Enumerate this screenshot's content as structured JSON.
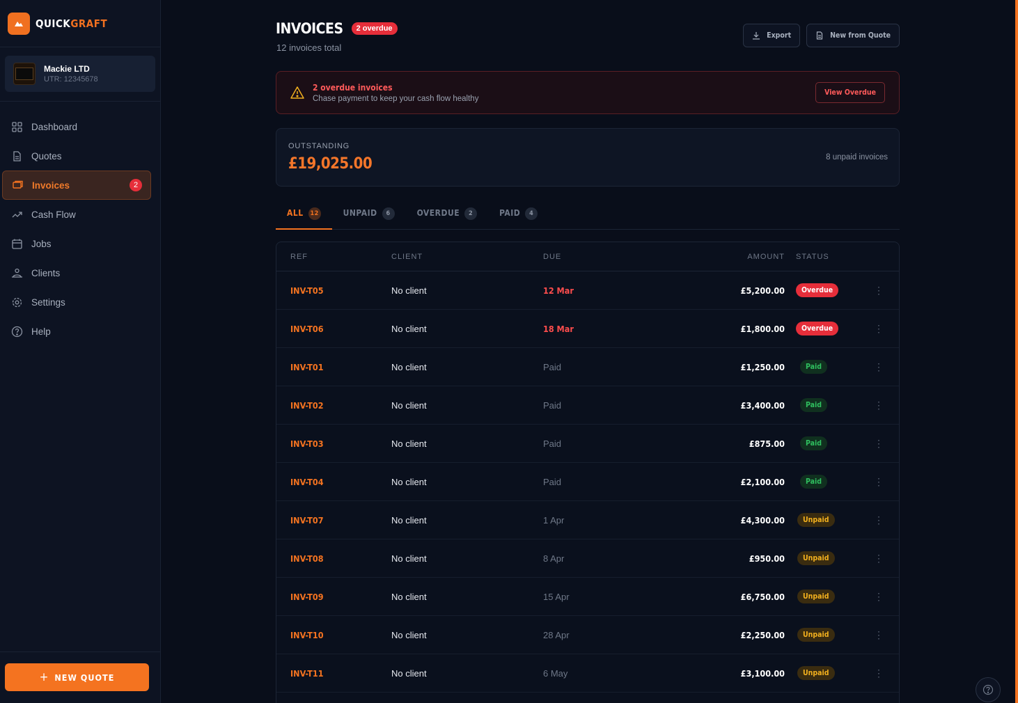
{
  "brand": {
    "name_a": "QUICK",
    "name_b": "GRAFT",
    "accent": "#f47320"
  },
  "org": {
    "name": "Mackie LTD",
    "utr": "UTR: 12345678"
  },
  "nav": [
    {
      "label": "Dashboard",
      "icon": "dashboard-icon"
    },
    {
      "label": "Quotes",
      "icon": "document-icon"
    },
    {
      "label": "Invoices",
      "icon": "invoice-icon",
      "badge": "2",
      "active": true
    },
    {
      "label": "Cash Flow",
      "icon": "trend-icon"
    },
    {
      "label": "Jobs",
      "icon": "calendar-icon"
    },
    {
      "label": "Clients",
      "icon": "users-icon"
    },
    {
      "label": "Settings",
      "icon": "gear-icon"
    },
    {
      "label": "Help",
      "icon": "help-icon"
    }
  ],
  "new_quote": "NEW QUOTE",
  "header": {
    "title": "INVOICES",
    "badge": "2 overdue",
    "subtitle": "12 invoices total",
    "export": "Export",
    "new_from_quote": "New from Quote"
  },
  "alert": {
    "title": "2 overdue invoices",
    "desc": "Chase payment to keep your cash flow healthy",
    "button": "View Overdue"
  },
  "outstanding": {
    "label": "OUTSTANDING",
    "value": "£19,025.00",
    "note": "8 unpaid invoices"
  },
  "tabs": [
    {
      "label": "ALL",
      "count": "12",
      "active": true
    },
    {
      "label": "UNPAID",
      "count": "6"
    },
    {
      "label": "OVERDUE",
      "count": "2"
    },
    {
      "label": "PAID",
      "count": "4"
    }
  ],
  "table": {
    "headers": {
      "ref": "REF",
      "client": "CLIENT",
      "due": "DUE",
      "amount": "AMOUNT",
      "status": "STATUS"
    },
    "rows": [
      {
        "ref": "INV-T05",
        "client": "No client",
        "due": "12 Mar",
        "amount": "£5,200.00",
        "status": "Overdue"
      },
      {
        "ref": "INV-T06",
        "client": "No client",
        "due": "18 Mar",
        "amount": "£1,800.00",
        "status": "Overdue"
      },
      {
        "ref": "INV-T01",
        "client": "No client",
        "due": "Paid",
        "amount": "£1,250.00",
        "status": "Paid"
      },
      {
        "ref": "INV-T02",
        "client": "No client",
        "due": "Paid",
        "amount": "£3,400.00",
        "status": "Paid"
      },
      {
        "ref": "INV-T03",
        "client": "No client",
        "due": "Paid",
        "amount": "£875.00",
        "status": "Paid"
      },
      {
        "ref": "INV-T04",
        "client": "No client",
        "due": "Paid",
        "amount": "£2,100.00",
        "status": "Paid"
      },
      {
        "ref": "INV-T07",
        "client": "No client",
        "due": "1 Apr",
        "amount": "£4,300.00",
        "status": "Unpaid"
      },
      {
        "ref": "INV-T08",
        "client": "No client",
        "due": "8 Apr",
        "amount": "£950.00",
        "status": "Unpaid"
      },
      {
        "ref": "INV-T09",
        "client": "No client",
        "due": "15 Apr",
        "amount": "£6,750.00",
        "status": "Unpaid"
      },
      {
        "ref": "INV-T10",
        "client": "No client",
        "due": "28 Apr",
        "amount": "£2,250.00",
        "status": "Unpaid"
      },
      {
        "ref": "INV-T11",
        "client": "No client",
        "due": "6 May",
        "amount": "£3,100.00",
        "status": "Unpaid"
      }
    ]
  }
}
